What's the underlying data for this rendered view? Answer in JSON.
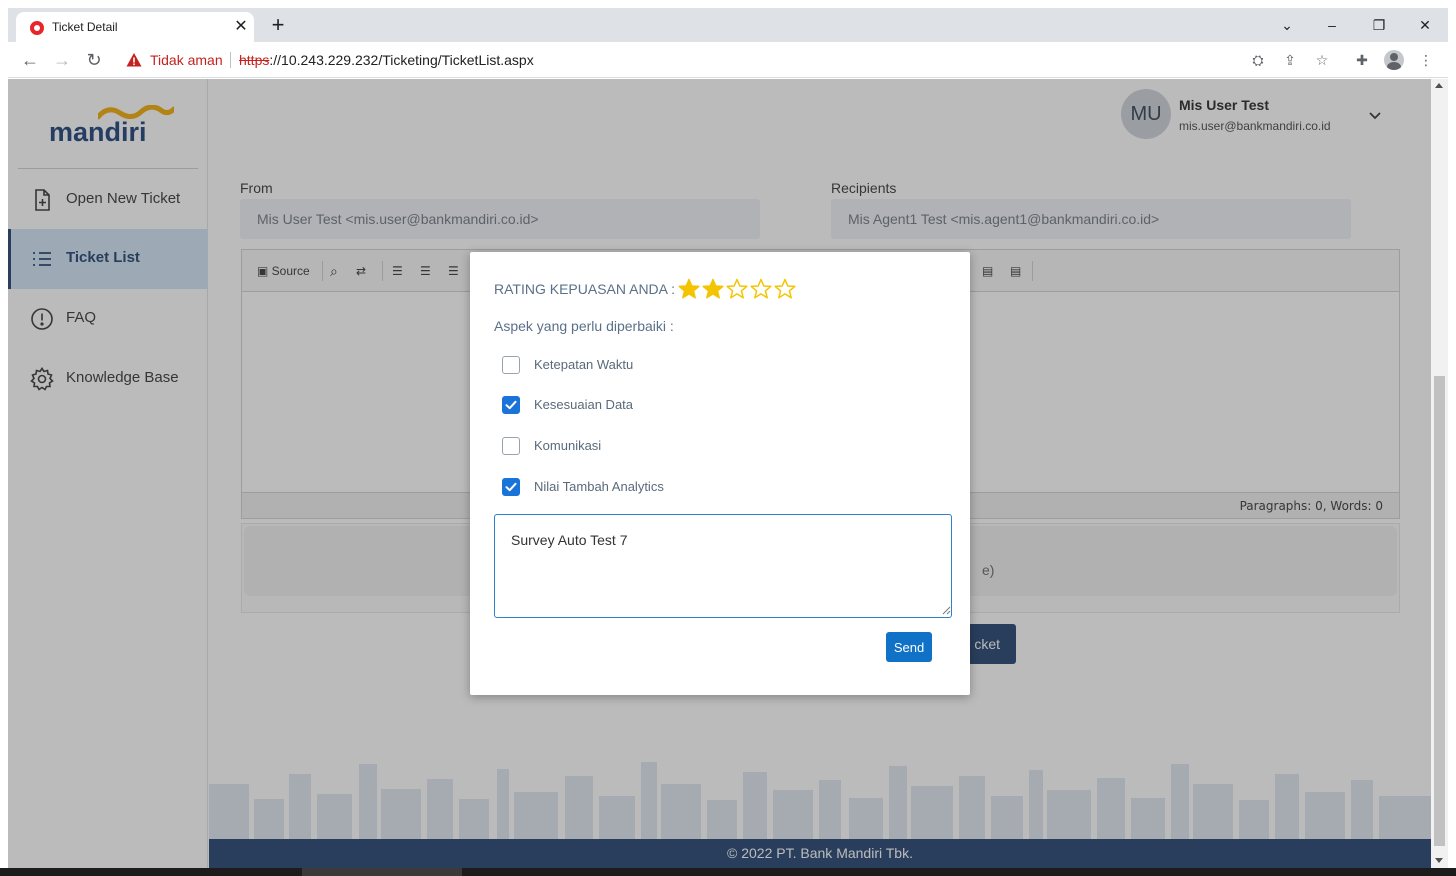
{
  "browser": {
    "tab_title": "Ticket Detail",
    "new_tab": "+",
    "security_label": "Tidak aman",
    "url_scheme": "https",
    "url_rest": "://10.243.229.232/Ticketing/TicketList.aspx"
  },
  "logo": {
    "text": "mandiri"
  },
  "sidebar": {
    "items": [
      {
        "label": "Open New Ticket",
        "icon": "file-plus-icon"
      },
      {
        "label": "Ticket List",
        "icon": "list-icon",
        "active": true
      },
      {
        "label": "FAQ",
        "icon": "info-circle-icon"
      },
      {
        "label": "Knowledge Base",
        "icon": "gear-icon"
      }
    ]
  },
  "user": {
    "initials": "MU",
    "name": "Mis User Test",
    "email": "mis.user@bankmandiri.co.id"
  },
  "form": {
    "from_label": "From",
    "from_value": "Mis User Test <mis.user@bankmandiri.co.id>",
    "recipients_label": "Recipients",
    "recipients_value": "Mis Agent1 Test <mis.agent1@bankmandiri.co.id>",
    "editor_source": "Source",
    "editor_status": "Paragraphs: 0, Words: 0",
    "attach_hint_partial": "e)",
    "submit_partial": "cket"
  },
  "footer": {
    "text": "© 2022 PT. Bank Mandiri Tbk."
  },
  "modal": {
    "rating_label": "RATING KEPUASAN ANDA :",
    "rating_value": 2,
    "rating_max": 5,
    "aspect_label": "Aspek yang perlu diperbaiki :",
    "options": [
      {
        "label": "Ketepatan Waktu",
        "checked": false
      },
      {
        "label": "Kesesuaian Data",
        "checked": true
      },
      {
        "label": "Komunikasi",
        "checked": false
      },
      {
        "label": "Nilai Tambah Analytics",
        "checked": true
      }
    ],
    "comment": "Survey Auto Test 7",
    "send_label": "Send"
  },
  "colors": {
    "brand_navy": "#1f3f6e",
    "star_filled": "#f5c400",
    "checkbox_checked": "#1a73d9",
    "send_button": "#0f72c7"
  }
}
